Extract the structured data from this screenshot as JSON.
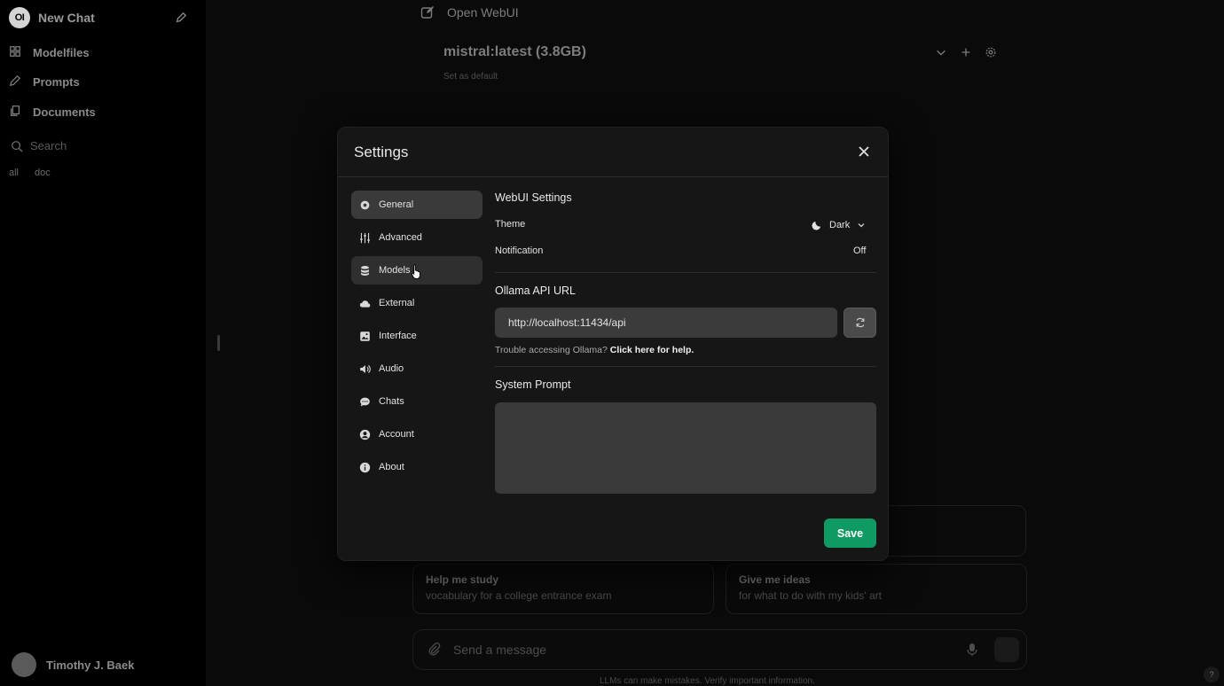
{
  "sidebar": {
    "logo_text": "OI",
    "new_chat_label": "New Chat",
    "items": [
      {
        "label": "Modelfiles",
        "icon": "grid-icon"
      },
      {
        "label": "Prompts",
        "icon": "pencil-icon"
      },
      {
        "label": "Documents",
        "icon": "documents-icon"
      }
    ],
    "search_placeholder": "Search",
    "tags": [
      "all",
      "doc"
    ],
    "user_name": "Timothy J. Baek"
  },
  "header": {
    "title": "Open WebUI",
    "model_name": "mistral:latest (3.8GB)",
    "set_default_label": "Set as default"
  },
  "suggestions": [
    {
      "title": "Help me study",
      "subtitle": "vocabulary for a college entrance exam"
    },
    {
      "title": "Give me ideas",
      "subtitle": "for what to do with my kids' art"
    }
  ],
  "composer": {
    "placeholder": "Send a message",
    "disclaimer": "LLMs can make mistakes. Verify important information.",
    "help_label": "?"
  },
  "settings": {
    "title": "Settings",
    "tabs": [
      {
        "label": "General",
        "icon": "gear-icon"
      },
      {
        "label": "Advanced",
        "icon": "sliders-icon"
      },
      {
        "label": "Models",
        "icon": "database-icon"
      },
      {
        "label": "External",
        "icon": "cloud-icon"
      },
      {
        "label": "Interface",
        "icon": "image-icon"
      },
      {
        "label": "Audio",
        "icon": "speaker-icon"
      },
      {
        "label": "Chats",
        "icon": "chat-bubble-icon"
      },
      {
        "label": "Account",
        "icon": "user-circle-icon"
      },
      {
        "label": "About",
        "icon": "info-icon"
      }
    ],
    "active_tab": "General",
    "webui_heading": "WebUI Settings",
    "theme_label": "Theme",
    "theme_value": "Dark",
    "notification_label": "Notification",
    "notification_value": "Off",
    "ollama_heading": "Ollama API URL",
    "ollama_url": "http://localhost:11434/api",
    "help_text": "Trouble accessing Ollama?",
    "help_link": "Click here for help.",
    "system_prompt_heading": "System Prompt",
    "system_prompt_value": "",
    "save_label": "Save"
  },
  "colors": {
    "modal_bg": "#161616",
    "active_tab": "#3a3a3a",
    "save_button": "#0e9a62",
    "input_bg": "#3b3b3b"
  }
}
